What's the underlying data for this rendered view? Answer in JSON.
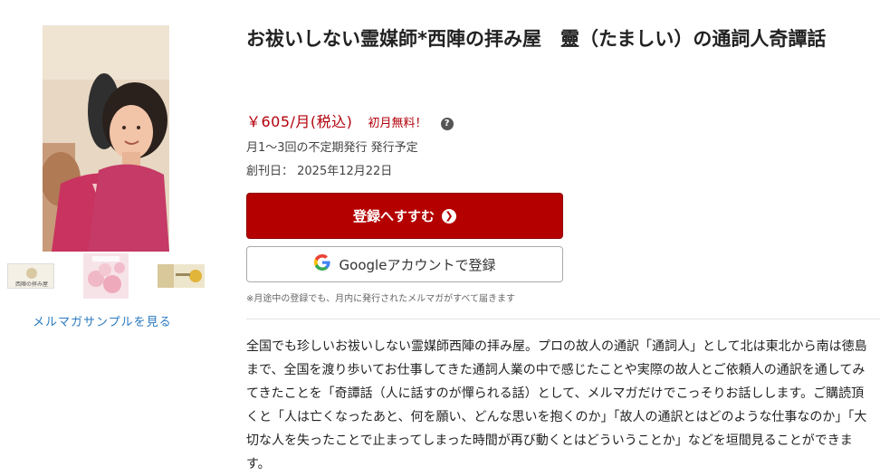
{
  "newsletter": {
    "title": "お祓いしない霊媒師*西陣の拝み屋　靈（たましい）の通詞人奇譚話",
    "price": "￥605/月(税込)",
    "promo": "初月無料！",
    "help_icon": "?",
    "frequency": "月1～3回の不定期発行 発行予定",
    "first_issue": "創刊日：  2025年12月22日",
    "description": "全国でも珍しいお祓いしない霊媒師西陣の拝み屋。プロの故人の通訳「通詞人」として北は東北から南は徳島まで、全国を渡り歩いてお仕事してきた通詞人業の中で感じたことや実際の故人とご依頼人の通訳を通してみてきたことを「奇譚話（人に話すのが憚られる話）として、メルマガだけでこっそりお話しします。ご購読頂くと「人は亡くなったあと、何を願い、どんな思いを抱くのか」「故人の通訳とはどのような仕事なのか」「大切な人を失ったことで止まってしまった時間が再び動くとはどういうことか」などを垣間見ることができます。"
  },
  "gallery": {
    "main_image": "author-photo",
    "thumbnails": [
      "thumbnail-logo",
      "thumbnail-pink-flowers",
      "thumbnail-gold-banner"
    ],
    "thumb1_text": "西陣の拝み屋",
    "sample_link": "メルマガサンプルを見る"
  },
  "actions": {
    "register": "登録へすすむ",
    "google": "Googleアカウントで登録",
    "note": "※月途中の登録でも、月内に発行されたメルマガがすべて届きます"
  },
  "colors": {
    "accent_red": "#b50000",
    "price_red": "#b3000b",
    "link_blue": "#2a7ac0"
  }
}
